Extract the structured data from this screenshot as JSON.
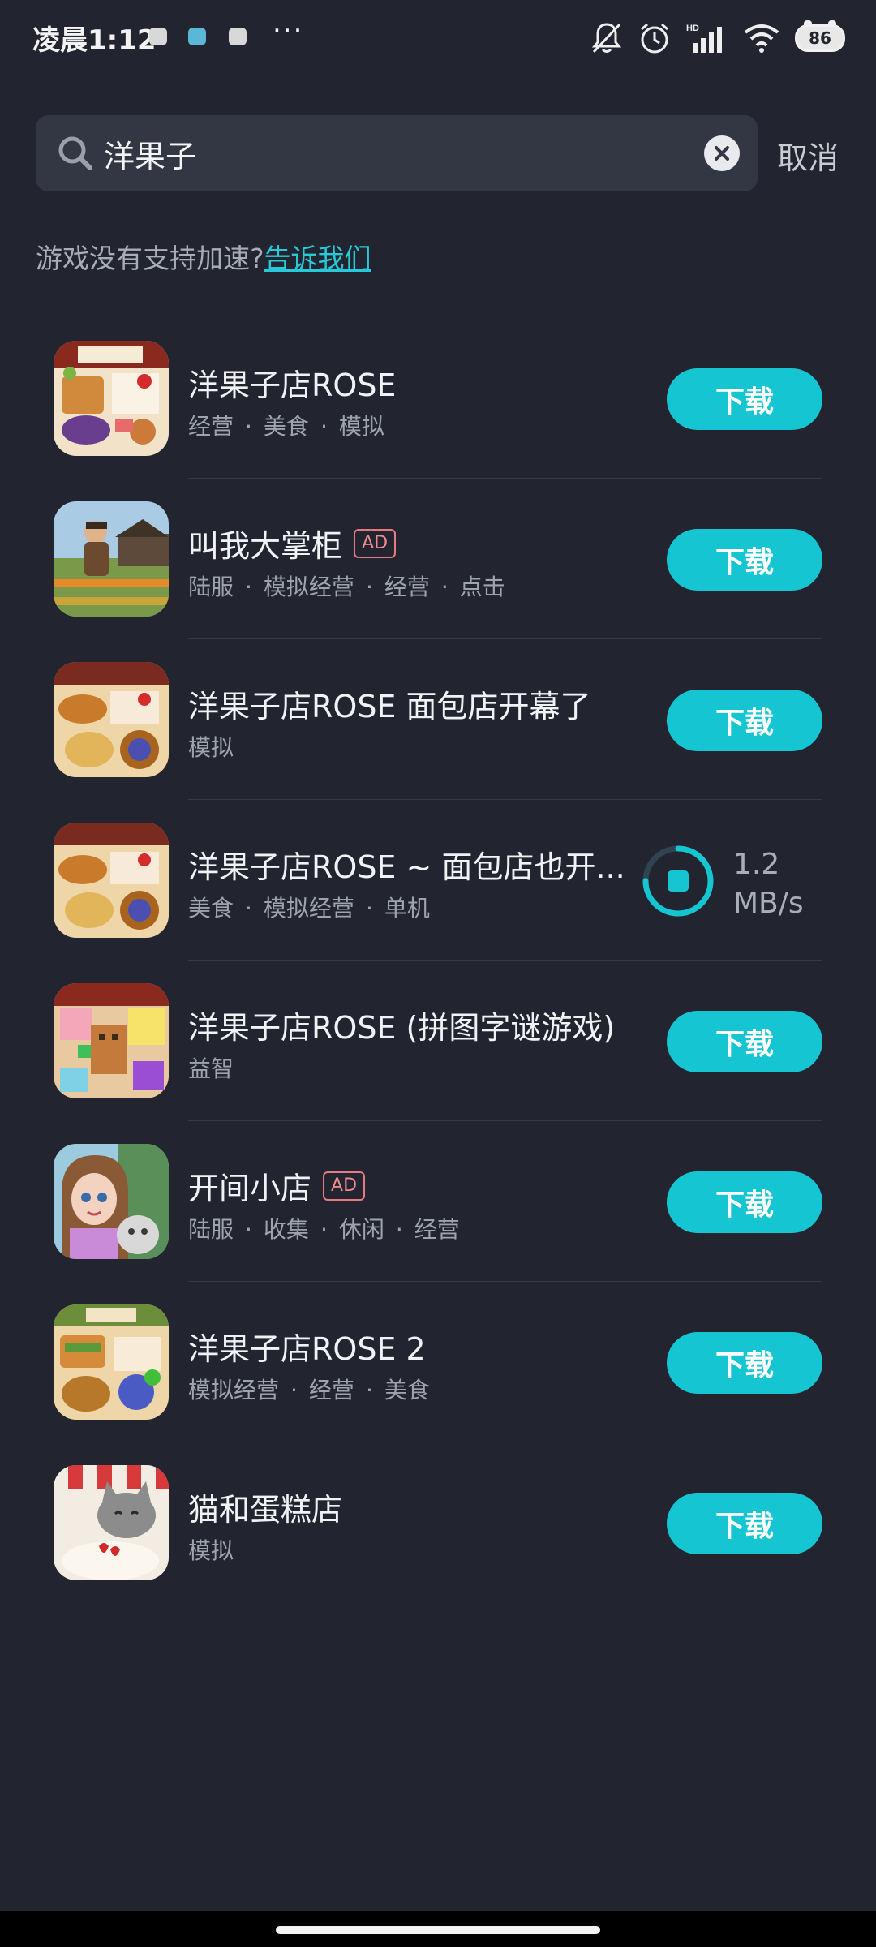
{
  "status_bar": {
    "time": "凌晨1:12",
    "dots": "···",
    "battery": "86",
    "signal_label": "HD"
  },
  "search": {
    "query": "洋果子",
    "cancel_label": "取消"
  },
  "hint": {
    "text": "游戏没有支持加速?",
    "link": "告诉我们"
  },
  "apps": [
    {
      "name": "洋果子店ROSE",
      "ad": false,
      "tags": [
        "经营",
        "美食",
        "模拟"
      ],
      "action": "下载"
    },
    {
      "name": "叫我大掌柜",
      "ad": true,
      "ad_label": "AD",
      "tags": [
        "陆服",
        "模拟经营",
        "经营",
        "点击"
      ],
      "action": "下载"
    },
    {
      "name": "洋果子店ROSE 面包店开幕了",
      "ad": false,
      "tags": [
        "模拟"
      ],
      "action": "下载"
    },
    {
      "name": "洋果子店ROSE ~ 面包店也开...",
      "ad": false,
      "tags": [
        "美食",
        "模拟经营",
        "单机"
      ],
      "downloading": true,
      "speed": "1.2",
      "speed_unit": "MB/s",
      "progress": 0.75
    },
    {
      "name": "洋果子店ROSE (拼图字谜游戏)",
      "ad": false,
      "tags": [
        "益智"
      ],
      "action": "下载"
    },
    {
      "name": "开间小店",
      "ad": true,
      "ad_label": "AD",
      "tags": [
        "陆服",
        "收集",
        "休闲",
        "经营"
      ],
      "action": "下载"
    },
    {
      "name": "洋果子店ROSE 2",
      "ad": false,
      "tags": [
        "模拟经营",
        "经营",
        "美食"
      ],
      "action": "下载"
    },
    {
      "name": "猫和蛋糕店",
      "ad": false,
      "tags": [
        "模拟"
      ],
      "action": "下载"
    }
  ],
  "colors": {
    "background": "#22252f",
    "accent": "#16c5d2",
    "ad_badge": "#e57a80"
  }
}
